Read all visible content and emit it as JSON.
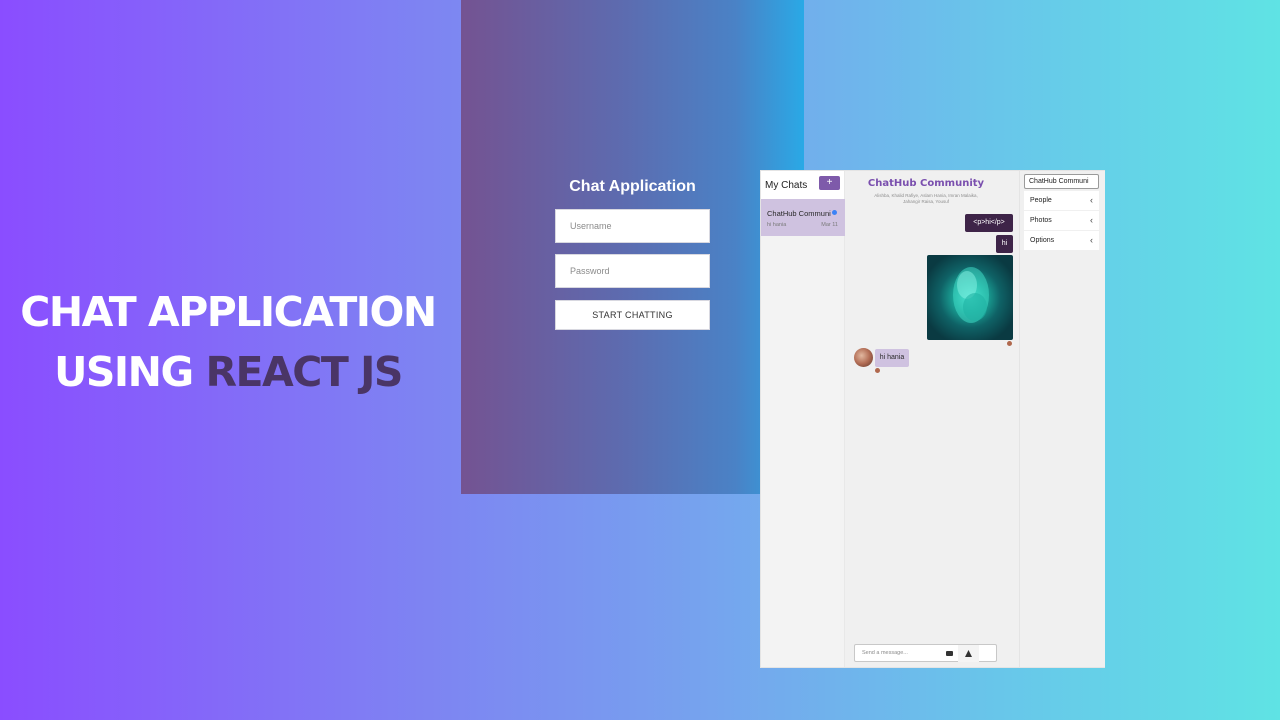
{
  "hero": {
    "line1": "CHAT APPLICATION",
    "line2_prefix": "USING ",
    "line2_accent": "REACT JS"
  },
  "login": {
    "title": "Chat Application",
    "username_placeholder": "Username",
    "password_placeholder": "Password",
    "submit_label": "START CHATTING"
  },
  "chat_list": {
    "title": "My Chats",
    "new_chat_label": "+",
    "chats": [
      {
        "title": "ChatHub Communi",
        "preview": "hi hania",
        "date": "Mar 11"
      }
    ]
  },
  "feed": {
    "title": "ChatHub Community",
    "members": "Alishba, Khalid Rafiye, Aslam Hania, Imran Malaika, Jahangir Raisa, Yousuf",
    "messages": [
      {
        "from": "me",
        "text": "<p>hi</p>"
      },
      {
        "from": "me",
        "text": "hi"
      },
      {
        "from": "me",
        "type": "image"
      },
      {
        "from": "other",
        "text": "hi hania"
      }
    ],
    "composer_placeholder": "Send a message..."
  },
  "settings": {
    "chat_title": "ChatHub Communi",
    "sections": [
      "People",
      "Photos",
      "Options"
    ]
  },
  "icons": {
    "new_chat": "plus-icon",
    "upload": "image-upload-icon",
    "send": "send-icon",
    "chevron": "chevron-left-icon"
  },
  "colors": {
    "accent": "#7e5aaa",
    "bubble_out": "#3e2448",
    "bubble_in": "#cfc2e0",
    "hero_accent": "#4a3566"
  }
}
